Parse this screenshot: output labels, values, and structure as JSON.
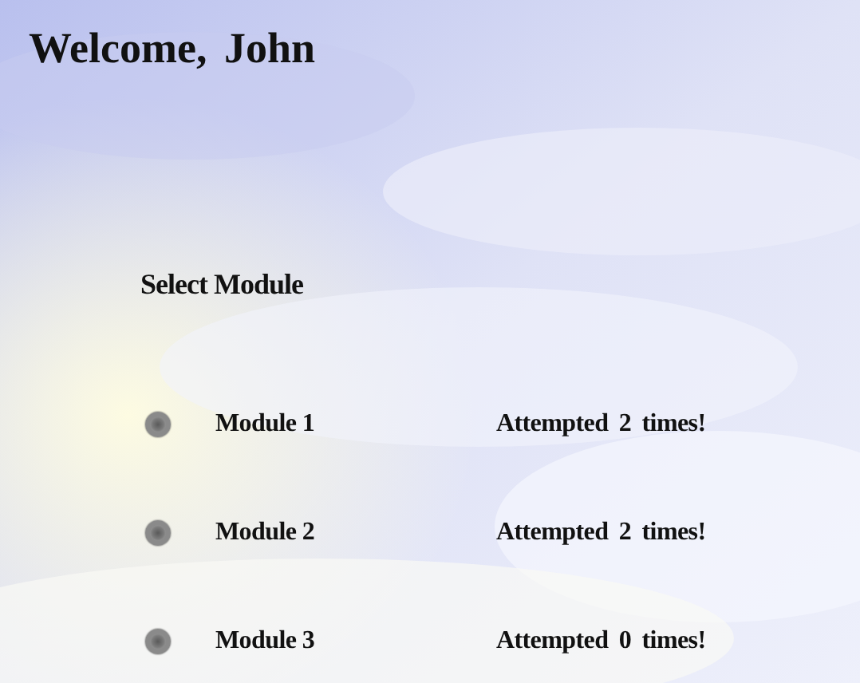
{
  "title": "Welcome, John",
  "heading": "Select Module",
  "modules": [
    {
      "label": "Module 1",
      "selected": false,
      "attempts": "Attempted 2 times!"
    },
    {
      "label": "Module 2",
      "selected": false,
      "attempts": "Attempted 2 times!"
    },
    {
      "label": "Module 3",
      "selected": false,
      "attempts": "Attempted 0 times!"
    }
  ]
}
